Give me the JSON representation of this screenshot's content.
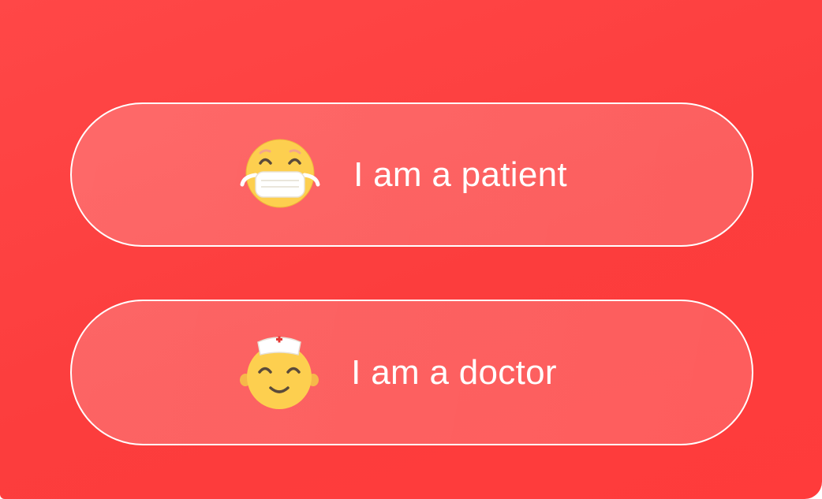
{
  "colors": {
    "background": "#fc4040",
    "button_border": "#ffffff",
    "text": "#ffffff",
    "emoji_face": "#fdcf4f"
  },
  "roles": {
    "patient": {
      "label": "I am a patient",
      "icon": "face-with-medical-mask-icon"
    },
    "doctor": {
      "label": "I am a doctor",
      "icon": "health-worker-face-icon"
    }
  }
}
